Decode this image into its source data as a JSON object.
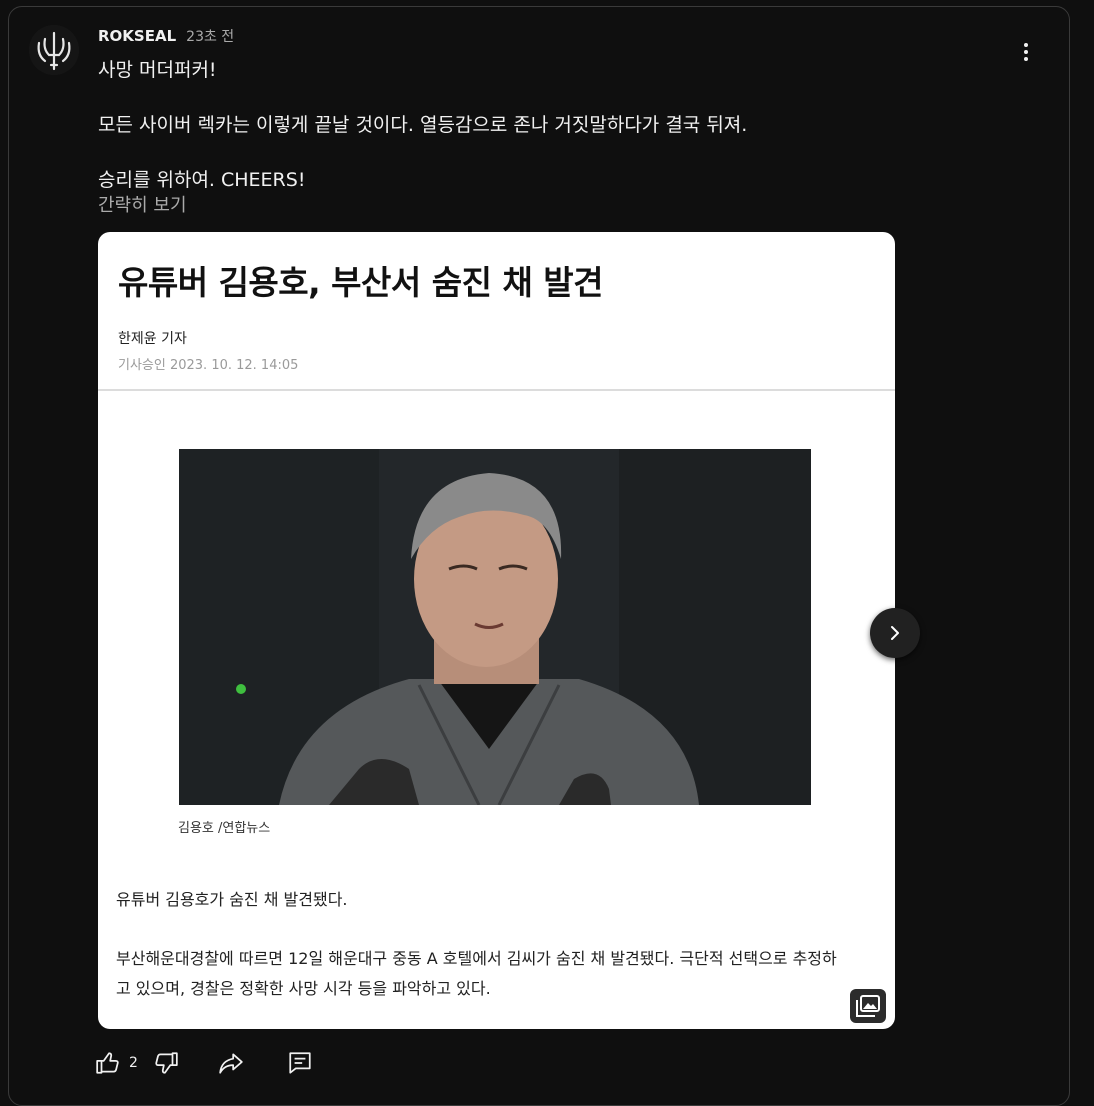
{
  "post": {
    "author": "ROKSEAL",
    "time": "23초 전",
    "lines": [
      "사망 머더퍼커!",
      "모든 사이버 렉카는 이렇게 끝날 것이다. 열등감으로 존나 거짓말하다가 결국 뒤져.",
      "승리를 위하여. CHEERS!"
    ],
    "collapse_label": "간략히 보기"
  },
  "article": {
    "headline": "유튜버 김용호, 부산서 숨진 채 발견",
    "reporter": "한제윤 기자",
    "published": "기사승인 2023. 10. 12. 14:05",
    "caption": "김용호 /연합뉴스",
    "paragraph1": "유튜버 김용호가 숨진 채 발견됐다.",
    "paragraph2_line1": "부산해운대경찰에 따르면 12일 해운대구 중동 A 호텔에서 김씨가 숨진 채 발견됐다. 극단적 선택으로 추정하",
    "paragraph2_line2": "고 있으며, 경찰은 정확한 사망 시각 등을 파악하고 있다."
  },
  "actions": {
    "like_count": "2"
  },
  "icons": {
    "menu": "more-vert-icon",
    "next": "chevron-right-icon",
    "gallery": "image-gallery-icon",
    "like": "thumb-up-icon",
    "dislike": "thumb-down-icon",
    "share": "share-icon",
    "comment": "comment-icon"
  },
  "colors": {
    "background": "#0f0f0f",
    "text": "#f1f1f1",
    "muted": "#aaaaaa"
  }
}
